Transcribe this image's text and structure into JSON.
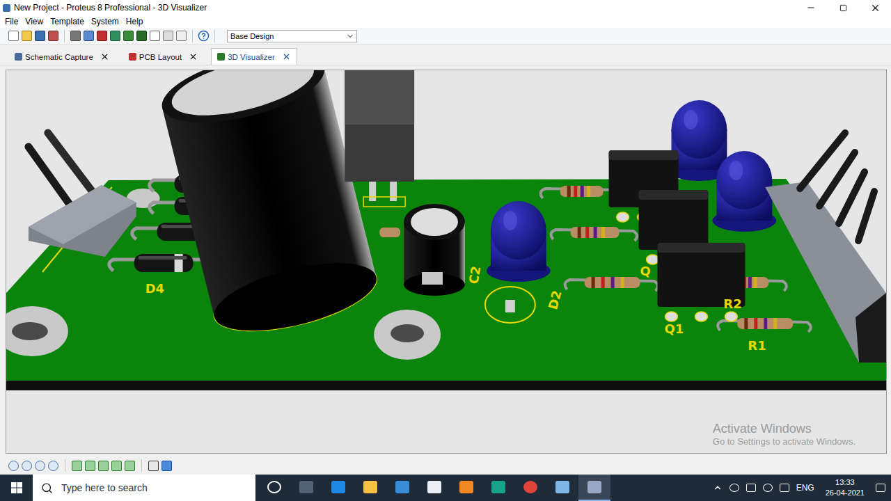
{
  "window": {
    "title": "New Project - Proteus 8 Professional - 3D Visualizer"
  },
  "menu": [
    "File",
    "View",
    "Template",
    "System",
    "Help"
  ],
  "toolbar": {
    "variant": "Base Design"
  },
  "tabs": [
    {
      "label": "Schematic Capture",
      "selected": false
    },
    {
      "label": "PCB Layout",
      "selected": false
    },
    {
      "label": "3D Visualizer",
      "selected": true
    }
  ],
  "viewport": {
    "labels": [
      "D4",
      "C2",
      "D2",
      "Q1",
      "R2",
      "R1",
      "Q"
    ]
  },
  "watermark": {
    "title": "Activate Windows",
    "subtitle": "Go to Settings to activate Windows."
  },
  "taskbar": {
    "search": "Type here to search",
    "language": "ENG",
    "time": "13:33",
    "date": "26-04-2021"
  }
}
